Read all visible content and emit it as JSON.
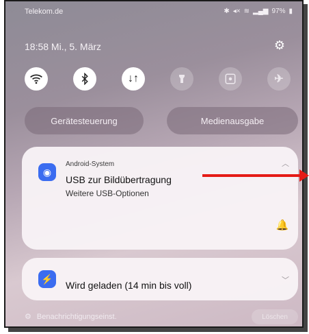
{
  "status_bar": {
    "carrier": "Telekom.de",
    "battery": "97%",
    "icons": [
      "bluetooth-icon",
      "mute-icon",
      "wifi-icon",
      "signal-icon",
      "battery-icon"
    ]
  },
  "header": {
    "datetime": "18:58  Mi., 5. März",
    "settings_icon": "gear-icon"
  },
  "quick_tiles": [
    {
      "name": "wifi",
      "icon": "wifi-icon",
      "state": "on"
    },
    {
      "name": "bluetooth",
      "icon": "bluetooth-icon",
      "state": "on"
    },
    {
      "name": "mobile-data",
      "icon": "data-transfer-icon",
      "state": "on"
    },
    {
      "name": "flashlight",
      "icon": "flashlight-icon",
      "state": "off"
    },
    {
      "name": "screen-capture",
      "icon": "screen-capture-icon",
      "state": "off"
    },
    {
      "name": "airplane-mode",
      "icon": "airplane-icon",
      "state": "off"
    }
  ],
  "buttons": {
    "device_control": "Gerätesteuerung",
    "media_output": "Medienausgabe"
  },
  "notifications": [
    {
      "app": "Android-System",
      "title": "USB zur Bildübertragung",
      "text": "Weitere USB-Optionen",
      "icon": "android-system-icon"
    },
    {
      "title": "Wird geladen (14 min bis voll)",
      "icon": "charging-icon"
    }
  ],
  "footer": {
    "settings_label": "Benachrichtigungseinst.",
    "clear_label": "Löschen"
  },
  "colors": {
    "accent": "#3b6cf0",
    "annotation_arrow": "#e51b16"
  }
}
